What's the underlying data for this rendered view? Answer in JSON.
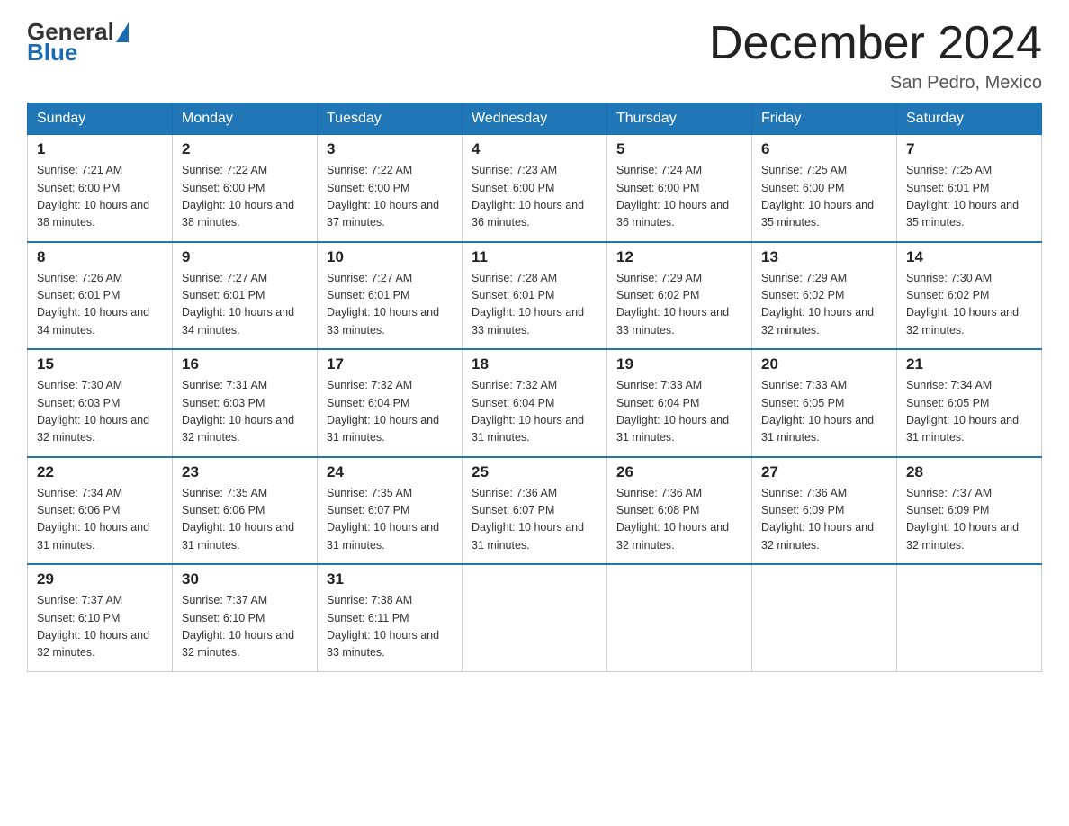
{
  "logo": {
    "general": "General",
    "blue": "Blue"
  },
  "title": "December 2024",
  "location": "San Pedro, Mexico",
  "days_of_week": [
    "Sunday",
    "Monday",
    "Tuesday",
    "Wednesday",
    "Thursday",
    "Friday",
    "Saturday"
  ],
  "weeks": [
    [
      {
        "day": "1",
        "sunrise": "7:21 AM",
        "sunset": "6:00 PM",
        "daylight": "10 hours and 38 minutes."
      },
      {
        "day": "2",
        "sunrise": "7:22 AM",
        "sunset": "6:00 PM",
        "daylight": "10 hours and 38 minutes."
      },
      {
        "day": "3",
        "sunrise": "7:22 AM",
        "sunset": "6:00 PM",
        "daylight": "10 hours and 37 minutes."
      },
      {
        "day": "4",
        "sunrise": "7:23 AM",
        "sunset": "6:00 PM",
        "daylight": "10 hours and 36 minutes."
      },
      {
        "day": "5",
        "sunrise": "7:24 AM",
        "sunset": "6:00 PM",
        "daylight": "10 hours and 36 minutes."
      },
      {
        "day": "6",
        "sunrise": "7:25 AM",
        "sunset": "6:00 PM",
        "daylight": "10 hours and 35 minutes."
      },
      {
        "day": "7",
        "sunrise": "7:25 AM",
        "sunset": "6:01 PM",
        "daylight": "10 hours and 35 minutes."
      }
    ],
    [
      {
        "day": "8",
        "sunrise": "7:26 AM",
        "sunset": "6:01 PM",
        "daylight": "10 hours and 34 minutes."
      },
      {
        "day": "9",
        "sunrise": "7:27 AM",
        "sunset": "6:01 PM",
        "daylight": "10 hours and 34 minutes."
      },
      {
        "day": "10",
        "sunrise": "7:27 AM",
        "sunset": "6:01 PM",
        "daylight": "10 hours and 33 minutes."
      },
      {
        "day": "11",
        "sunrise": "7:28 AM",
        "sunset": "6:01 PM",
        "daylight": "10 hours and 33 minutes."
      },
      {
        "day": "12",
        "sunrise": "7:29 AM",
        "sunset": "6:02 PM",
        "daylight": "10 hours and 33 minutes."
      },
      {
        "day": "13",
        "sunrise": "7:29 AM",
        "sunset": "6:02 PM",
        "daylight": "10 hours and 32 minutes."
      },
      {
        "day": "14",
        "sunrise": "7:30 AM",
        "sunset": "6:02 PM",
        "daylight": "10 hours and 32 minutes."
      }
    ],
    [
      {
        "day": "15",
        "sunrise": "7:30 AM",
        "sunset": "6:03 PM",
        "daylight": "10 hours and 32 minutes."
      },
      {
        "day": "16",
        "sunrise": "7:31 AM",
        "sunset": "6:03 PM",
        "daylight": "10 hours and 32 minutes."
      },
      {
        "day": "17",
        "sunrise": "7:32 AM",
        "sunset": "6:04 PM",
        "daylight": "10 hours and 31 minutes."
      },
      {
        "day": "18",
        "sunrise": "7:32 AM",
        "sunset": "6:04 PM",
        "daylight": "10 hours and 31 minutes."
      },
      {
        "day": "19",
        "sunrise": "7:33 AM",
        "sunset": "6:04 PM",
        "daylight": "10 hours and 31 minutes."
      },
      {
        "day": "20",
        "sunrise": "7:33 AM",
        "sunset": "6:05 PM",
        "daylight": "10 hours and 31 minutes."
      },
      {
        "day": "21",
        "sunrise": "7:34 AM",
        "sunset": "6:05 PM",
        "daylight": "10 hours and 31 minutes."
      }
    ],
    [
      {
        "day": "22",
        "sunrise": "7:34 AM",
        "sunset": "6:06 PM",
        "daylight": "10 hours and 31 minutes."
      },
      {
        "day": "23",
        "sunrise": "7:35 AM",
        "sunset": "6:06 PM",
        "daylight": "10 hours and 31 minutes."
      },
      {
        "day": "24",
        "sunrise": "7:35 AM",
        "sunset": "6:07 PM",
        "daylight": "10 hours and 31 minutes."
      },
      {
        "day": "25",
        "sunrise": "7:36 AM",
        "sunset": "6:07 PM",
        "daylight": "10 hours and 31 minutes."
      },
      {
        "day": "26",
        "sunrise": "7:36 AM",
        "sunset": "6:08 PM",
        "daylight": "10 hours and 32 minutes."
      },
      {
        "day": "27",
        "sunrise": "7:36 AM",
        "sunset": "6:09 PM",
        "daylight": "10 hours and 32 minutes."
      },
      {
        "day": "28",
        "sunrise": "7:37 AM",
        "sunset": "6:09 PM",
        "daylight": "10 hours and 32 minutes."
      }
    ],
    [
      {
        "day": "29",
        "sunrise": "7:37 AM",
        "sunset": "6:10 PM",
        "daylight": "10 hours and 32 minutes."
      },
      {
        "day": "30",
        "sunrise": "7:37 AM",
        "sunset": "6:10 PM",
        "daylight": "10 hours and 32 minutes."
      },
      {
        "day": "31",
        "sunrise": "7:38 AM",
        "sunset": "6:11 PM",
        "daylight": "10 hours and 33 minutes."
      },
      null,
      null,
      null,
      null
    ]
  ]
}
